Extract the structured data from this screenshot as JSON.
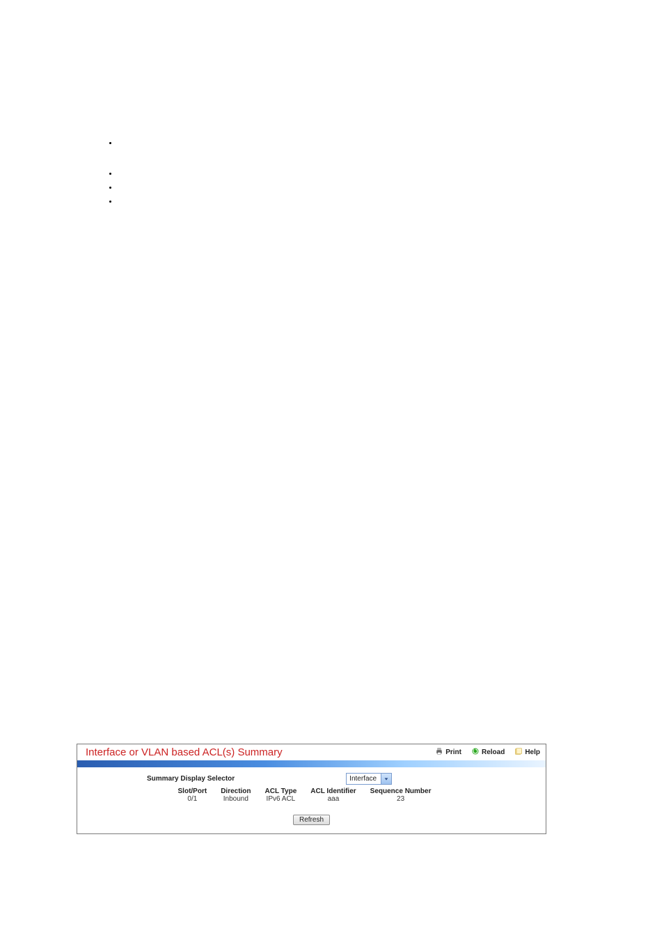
{
  "bullets": [
    "",
    "",
    "",
    ""
  ],
  "panel": {
    "title": "Interface or VLAN based ACL(s) Summary",
    "actions": {
      "print": "Print",
      "reload": "Reload",
      "help": "Help"
    },
    "selector": {
      "label": "Summary Display Selector",
      "value": "Interface"
    },
    "table": {
      "headers": {
        "slotport": "Slot/Port",
        "direction": "Direction",
        "acltype": "ACL Type",
        "aclid": "ACL Identifier",
        "seq": "Sequence Number"
      },
      "rows": [
        {
          "slotport": "0/1",
          "direction": "Inbound",
          "acltype": "IPv6 ACL",
          "aclid": "aaa",
          "seq": "23"
        }
      ]
    },
    "button": "Refresh"
  }
}
